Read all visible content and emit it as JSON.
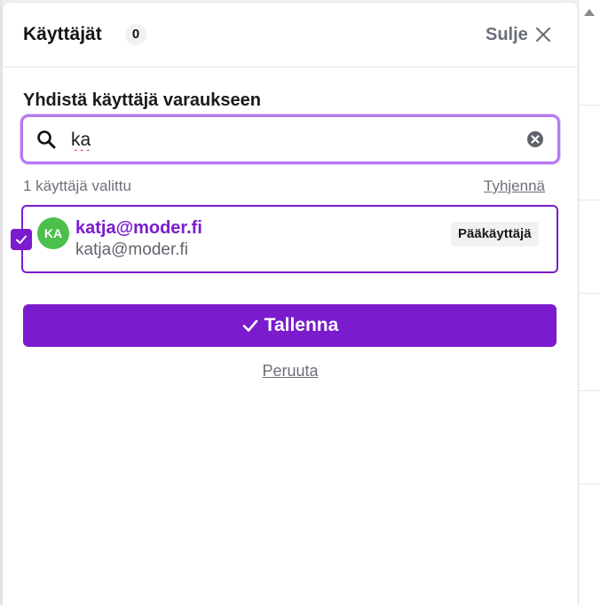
{
  "header": {
    "title": "Käyttäjät",
    "count": "0",
    "close_label": "Sulje"
  },
  "search": {
    "section_label": "Yhdistä käyttäjä varaukseen",
    "value": "ka",
    "placeholder": ""
  },
  "selection": {
    "count_text": "1 käyttäjä valittu",
    "clear_label": "Tyhjennä"
  },
  "results": [
    {
      "initials": "KA",
      "name": "katja@moder.fi",
      "email": "katja@moder.fi",
      "role": "Pääkäyttäjä",
      "selected": true,
      "avatar_color": "#4cc04a"
    }
  ],
  "actions": {
    "save_label": "Tallenna",
    "cancel_label": "Peruuta"
  },
  "colors": {
    "accent": "#7a1ccd",
    "focus_ring": "#b57af0",
    "muted_text": "#6d7079"
  }
}
